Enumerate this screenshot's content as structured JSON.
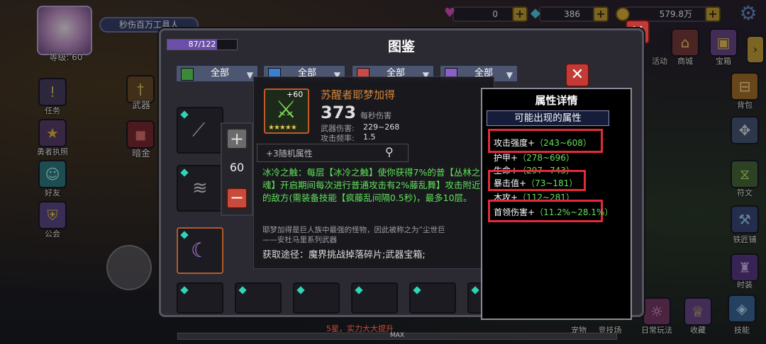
{
  "hud": {
    "player_title": "秒伤百万工具人",
    "level_label": "等级: 60",
    "gems": "0",
    "diamonds": "386",
    "gold": "579.8万"
  },
  "left_menu": [
    {
      "label": "任务"
    },
    {
      "label": "勇者执照"
    },
    {
      "label": "好友"
    },
    {
      "label": "公会"
    }
  ],
  "mid_menu": [
    {
      "label": "武器"
    },
    {
      "label": "暗金"
    }
  ],
  "right_menu": [
    {
      "label": "活动"
    },
    {
      "label": "商城"
    },
    {
      "label": "宝箱"
    },
    {
      "label": "背包"
    },
    {
      "label": "符文"
    },
    {
      "label": "铁匠铺"
    },
    {
      "label": "时装"
    }
  ],
  "bottom_menu": [
    {
      "label": "宠物"
    },
    {
      "label": "竞技场"
    },
    {
      "label": "日常玩法"
    },
    {
      "label": "收藏"
    },
    {
      "label": "技能"
    }
  ],
  "codex": {
    "title": "图鉴",
    "progress": "87/122",
    "progress_fraction": 0.713,
    "filters": [
      "全部",
      "全部",
      "全部",
      "全部"
    ],
    "filter_colors": [
      "#3a8a3a",
      "#3b7fd1",
      "#c84a4a",
      "#8a5fc8"
    ]
  },
  "weapon": {
    "name": "苏醒者耶梦加得",
    "level_badge": "+60",
    "stars": "★★★★★",
    "dps_value": "373",
    "dps_label": "每秒伤害",
    "damage_label": "武器伤害:",
    "damage_value": "229~268",
    "freq_label": "攻击频率:",
    "freq_value": "1.5",
    "random_attr": "+3随机属性",
    "enhance_value": "60",
    "skill_text": "冰冷之触：每层【冰冷之触】使你获得7%的普【丛林之魂】开启期间每次进行普通攻击有2%藤乱舞】攻击附近的敌方(需装备技能【疯藤乱间隔0.5秒)，最多10层。",
    "lore_text": "耶梦加得是巨人族中最强的怪物，因此被称之为“尘世巨",
    "lore_author": "——安杜马里系列武器",
    "source_label": "获取途径：",
    "source_value": "魔界挑战掉落碎片;武器宝箱;"
  },
  "attr_panel": {
    "title": "属性详情",
    "subtitle": "可能出现的属性",
    "items": [
      {
        "name": "攻击强度+",
        "value": "（243~608）",
        "highlight": true
      },
      {
        "name": "护甲+",
        "value": "（278~696）",
        "highlight": false
      },
      {
        "name": "生命+",
        "value": "（297~743）",
        "highlight": false
      },
      {
        "name": "暴击值+",
        "value": "（73~181）",
        "highlight": true
      },
      {
        "name": "木攻+",
        "value": "（112~281）",
        "highlight": false
      },
      {
        "name": "首领伤害+",
        "value": "（11.2%~28.1%）",
        "highlight": true
      }
    ]
  },
  "footer": {
    "hint": "5星，实力大大提升",
    "max_label": "MAX"
  }
}
